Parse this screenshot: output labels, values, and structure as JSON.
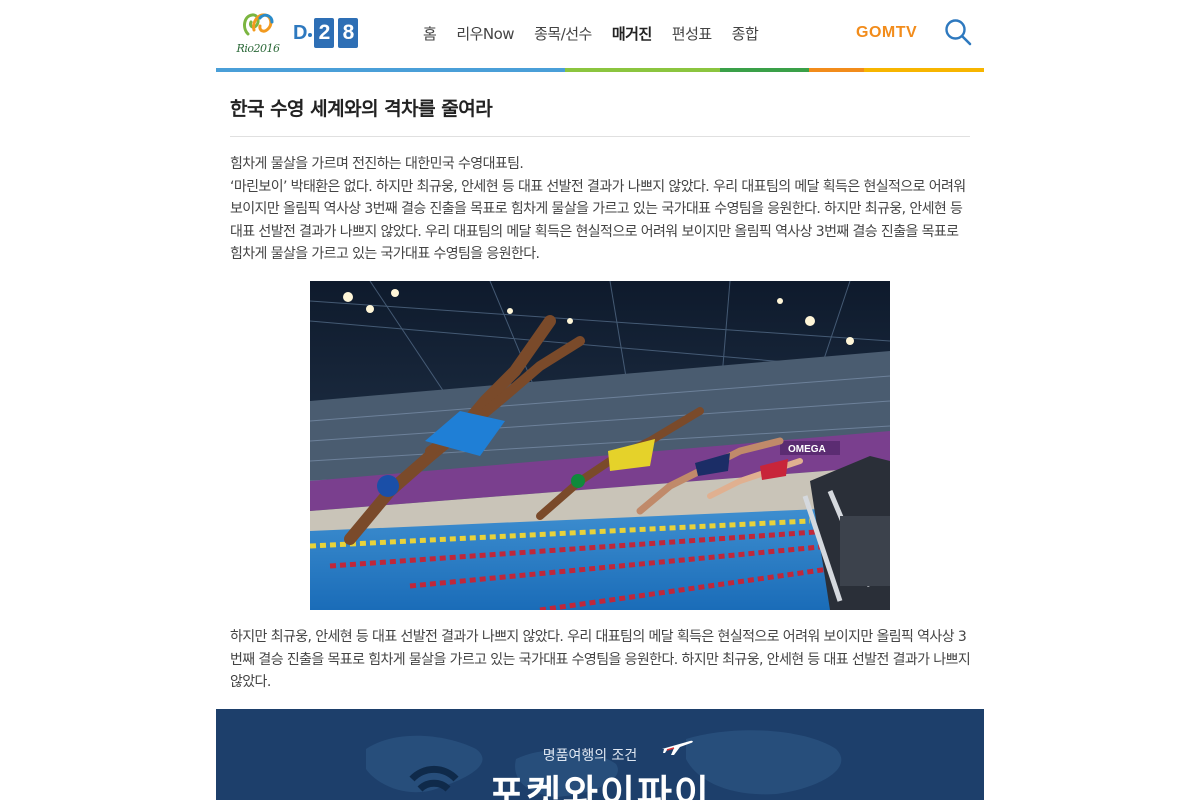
{
  "header": {
    "logo_text": "Rio2016",
    "dday_prefix": "D",
    "dday_digits": [
      "2",
      "8"
    ],
    "nav": [
      {
        "label": "홈",
        "active": false
      },
      {
        "label": "리우Now",
        "active": false
      },
      {
        "label": "종목/선수",
        "active": false
      },
      {
        "label": "매거진",
        "active": true
      },
      {
        "label": "편성표",
        "active": false
      },
      {
        "label": "종합",
        "active": false
      }
    ],
    "brand": "GOMTV",
    "search_icon": "search-icon",
    "colorbar": [
      "#4a9fd8",
      "#8bc53f",
      "#3aa048",
      "#f28c1b",
      "#f7b500"
    ]
  },
  "article": {
    "title": "한국 수영 세계와의 격차를 줄여라",
    "intro_lines": [
      "힘차게 물살을 가르며 전진하는 대한민국 수영대표팀.",
      "‘마린보이’ 박태환은 없다. 하지만 최규웅, 안세현 등 대표 선발전 결과가 나쁘지 않았다. 우리 대표팀의 메달 획득은 현실적으로 어려워 보이지만 올림픽 역사상 3번째 결승 진출을 목표로 힘차게 물살을 가르고 있는 국가대표 수영팀을 응원한다. 하지만 최규웅, 안세현 등 대표 선발전 결과가 나쁘지 않았다. 우리 대표팀의 메달 획득은 현실적으로 어려워 보이지만 올림픽 역사상 3번째 결승 진출을 목표로 힘차게 물살을 가르고 있는 국가대표 수영팀을 응원한다."
    ],
    "photo_sign": "OMEGA",
    "closing": "하지만 최규웅, 안세현 등 대표 선발전 결과가 나쁘지 않았다. 우리 대표팀의 메달 획득은 현실적으로 어려워 보이지만 올림픽 역사상 3번째 결승 진출을 목표로 힘차게 물살을 가르고 있는 국가대표 수영팀을 응원한다. 하지만 최규웅, 안세현 등 대표 선발전 결과가 나쁘지 않았다."
  },
  "banner": {
    "subtitle": "명품여행의 조건",
    "title": "포켓와이파이",
    "background": "#1d3f6b"
  }
}
